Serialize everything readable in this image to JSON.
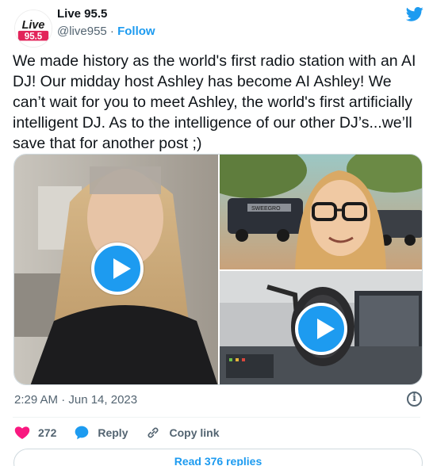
{
  "account": {
    "name": "Live 95.5",
    "handle": "@live955",
    "separator": " · ",
    "follow_label": "Follow",
    "logo_top": "Live",
    "logo_bottom": "95.5"
  },
  "tweet": {
    "text": "We made history as the world's first radio station with an AI DJ! Our midday host Ashley has become AI Ashley! We can’t wait for you to meet Ashley, the world's first artificially intelligent DJ. As to the intelligence of our other DJ’s...we’ll save that for another post ;)",
    "timestamp": "2:29 AM · Jun 14, 2023"
  },
  "media": {
    "items": [
      {
        "kind": "video",
        "description_icon": "play-icon"
      },
      {
        "kind": "image",
        "overlay_text": "SWEEGRO"
      },
      {
        "kind": "video",
        "description_icon": "play-icon"
      }
    ]
  },
  "actions": {
    "like_count": "272",
    "reply_label": "Reply",
    "copy_label": "Copy link"
  },
  "footer": {
    "read_replies_label": "Read 376 replies"
  },
  "colors": {
    "accent": "#1d9bf0",
    "like": "#f91880",
    "text": "#0f1419",
    "muted": "#536471"
  }
}
